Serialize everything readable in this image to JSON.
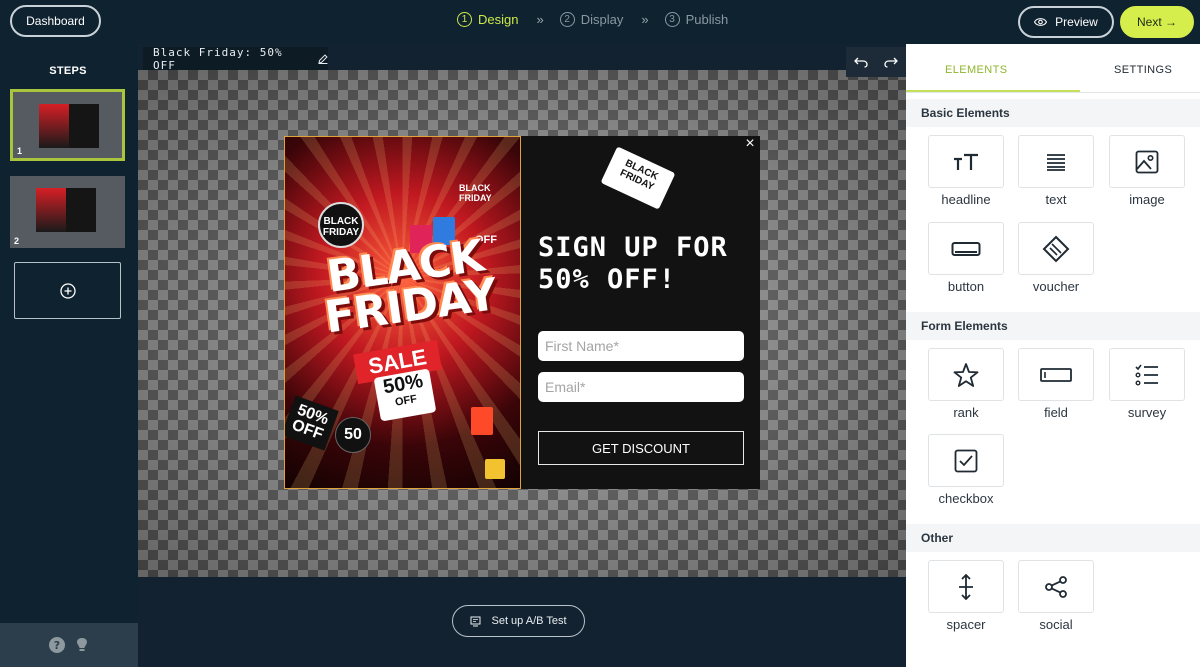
{
  "topbar": {
    "dashboard_label": "Dashboard",
    "steps": [
      {
        "num": "1",
        "label": "Design"
      },
      {
        "num": "2",
        "label": "Display"
      },
      {
        "num": "3",
        "label": "Publish"
      }
    ],
    "separator": "»",
    "preview_label": "Preview",
    "next_label": "Next →"
  },
  "sidebar": {
    "title": "STEPS",
    "thumbs": [
      {
        "num": "1"
      },
      {
        "num": "2"
      }
    ],
    "add_icon": "plus-circle-icon",
    "footer_icons": [
      "help-icon",
      "lightbulb-icon"
    ]
  },
  "canvas": {
    "title": "Black Friday: 50% OFF",
    "ab_test_label": "Set up A/B Test"
  },
  "popup": {
    "poster": {
      "tag_top": "BLACK FRIDAY",
      "circle": "BLACK FRIDAY",
      "big_line1": "BLACK",
      "big_line2": "FRIDAY",
      "sale": "SALE",
      "fifty": "50%",
      "off": "OFF",
      "off_tag": "OFF",
      "left_tag": "50% OFF",
      "circle50": "50"
    },
    "price_tag": "BLACK FRIDAY",
    "close": "×",
    "headline": "SIGN UP FOR 50% OFF!",
    "first_name_placeholder": "First Name*",
    "email_placeholder": "Email*",
    "cta_label": "GET DISCOUNT"
  },
  "panel": {
    "tabs": {
      "elements": "ELEMENTS",
      "settings": "SETTINGS"
    },
    "basic": {
      "title": "Basic Elements",
      "items": [
        {
          "label": "headline",
          "icon": "headline-icon"
        },
        {
          "label": "text",
          "icon": "text-icon"
        },
        {
          "label": "image",
          "icon": "image-icon"
        },
        {
          "label": "button",
          "icon": "button-icon"
        },
        {
          "label": "voucher",
          "icon": "voucher-icon"
        }
      ]
    },
    "form": {
      "title": "Form Elements",
      "items": [
        {
          "label": "rank",
          "icon": "star-icon"
        },
        {
          "label": "field",
          "icon": "field-icon"
        },
        {
          "label": "survey",
          "icon": "survey-icon"
        },
        {
          "label": "checkbox",
          "icon": "checkbox-icon"
        }
      ]
    },
    "other": {
      "title": "Other",
      "items": [
        {
          "label": "spacer",
          "icon": "spacer-icon"
        },
        {
          "label": "social",
          "icon": "share-icon"
        }
      ]
    }
  },
  "colors": {
    "accent": "#cde84a",
    "next_button": "#d6ee4b",
    "app_bg": "#132230",
    "popup_bg": "#121212"
  }
}
